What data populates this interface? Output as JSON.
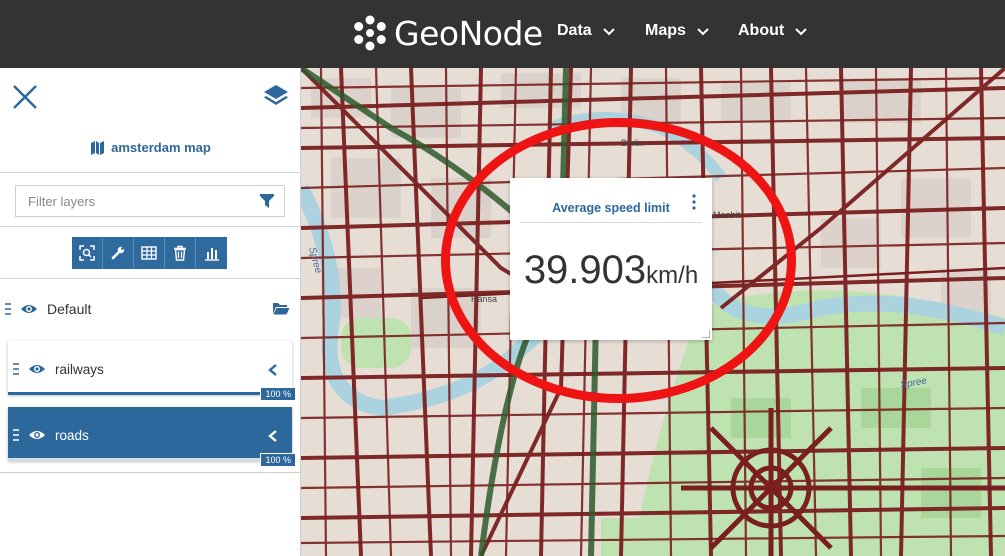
{
  "header": {
    "brand": "GeoNode",
    "nav": [
      {
        "label": "Data"
      },
      {
        "label": "Maps"
      },
      {
        "label": "About"
      }
    ]
  },
  "panel": {
    "map_title": "amsterdam map",
    "filter_placeholder": "Filter layers",
    "toolbar_icons": [
      "zoom-to-extent-icon",
      "settings-wrench-icon",
      "attribute-table-icon",
      "delete-icon",
      "widget-chart-icon"
    ],
    "group": {
      "label": "Default"
    },
    "layers": [
      {
        "name": "railways",
        "opacity": "100 %",
        "selected": false
      },
      {
        "name": "roads",
        "opacity": "100 %",
        "selected": true
      }
    ]
  },
  "widget": {
    "title": "Average speed limit",
    "value": "39.903",
    "unit": "km/h"
  },
  "map": {
    "labels": [
      "Spree",
      "Spree",
      "Berlin",
      "Moabit",
      "Hansa"
    ]
  },
  "colors": {
    "accent": "#2c689c",
    "topbar": "#333333",
    "annotation": "#ef1414",
    "road": "#7a1f1f"
  }
}
